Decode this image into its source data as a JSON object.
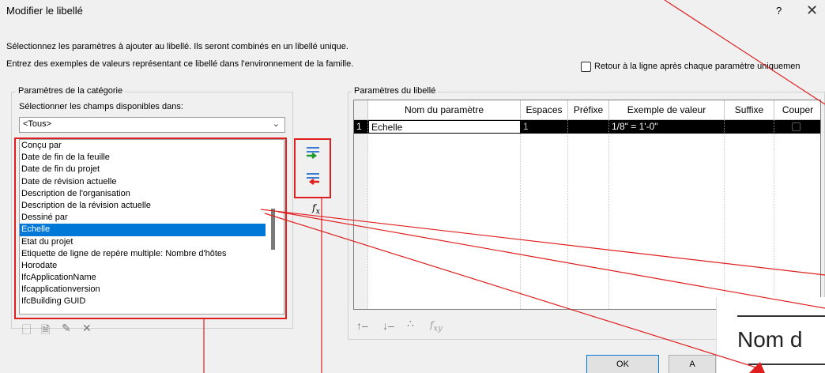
{
  "window": {
    "title": "Modifier le libellé",
    "help": "?",
    "close": "✕"
  },
  "instructions": {
    "line1": "Sélectionnez les paramètres à ajouter au libellé. Ils seront combinés en un libellé unique.",
    "line2": "Entrez des exemples de valeurs représentant ce libellé dans l'environnement de la famille."
  },
  "wrap_checkbox": {
    "label": "Retour à la ligne après chaque paramètre uniquemen",
    "checked": false
  },
  "category_group": {
    "title": "Paramètres de la catégorie",
    "select_label": "Sélectionner les champs disponibles dans:",
    "select_value": "<Tous>",
    "items": [
      "Conçu par",
      "Date de fin de la feuille",
      "Date de fin du projet",
      "Date de révision actuelle",
      "Description de l'organisation",
      "Description de la révision actuelle",
      "Dessiné par",
      "Echelle",
      "Etat du projet",
      "Etiquette de ligne de repère multiple: Nombre d'hôtes",
      "Horodate",
      "IfcApplicationName",
      "Ifcapplicationversion",
      "IfcBuilding GUID"
    ],
    "selected_index": 7
  },
  "label_group": {
    "title": "Paramètres du libellé",
    "columns": [
      "Nom du paramètre",
      "Espaces",
      "Préfixe",
      "Exemple de valeur",
      "Suffixe",
      "Couper"
    ],
    "rows": [
      {
        "num": "1",
        "name": "Echelle",
        "spaces": "1",
        "prefix": "",
        "example": "1/8\" = 1'-0\"",
        "suffix": "",
        "break": false
      }
    ]
  },
  "buttons": {
    "ok": "OK",
    "cancel_partial": "A"
  },
  "zoom_overlay": {
    "text": "Nom d"
  },
  "colors": {
    "selection": "#0078d7",
    "annotation": "#e01e1e"
  }
}
